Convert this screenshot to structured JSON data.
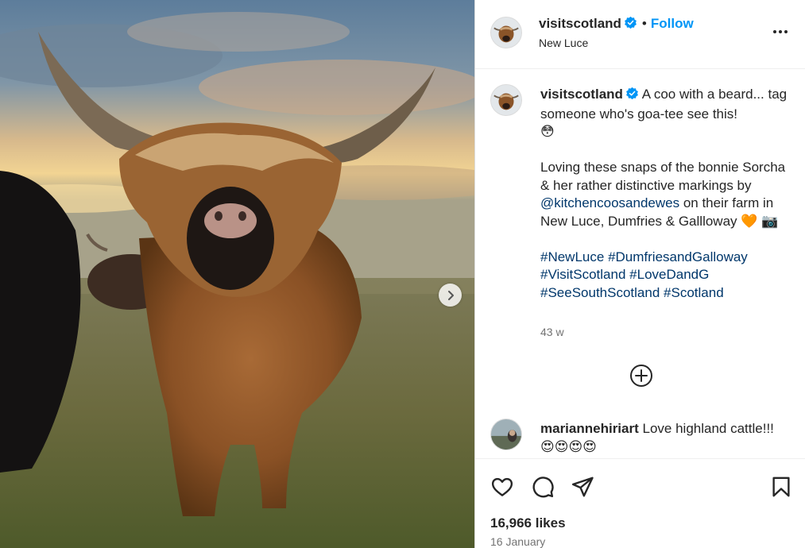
{
  "post": {
    "username": "visitscotland",
    "follow_label": "Follow",
    "separator": "•",
    "location": "New Luce",
    "more_label": "..."
  },
  "caption": {
    "username": "visitscotland",
    "line1": "A coo with a beard... tag someone who's goa-tee see this!",
    "emoji1": "😳",
    "para2_prefix": "Loving these snaps of the bonnie Sorcha & her rather distinctive markings by ",
    "mention": "@kitchencoosandewes",
    "para2_suffix": " on their farm in New Luce, Dumfries & Gallloway ",
    "emoji2": "🧡 📷",
    "hashtags": [
      "#NewLuce",
      "#DumfriesandGalloway",
      "#VisitScotland",
      "#LoveDandG",
      "#SeeSouthScotland",
      "#Scotland"
    ],
    "time_ago": "43 w"
  },
  "comment": {
    "username": "mariannehiriart",
    "text": "Love highland cattle!!!",
    "emojis": "😍😍😍😍"
  },
  "footer": {
    "likes": "16,966 likes",
    "date": "16 January"
  },
  "icons": {
    "like": "heart-icon",
    "comment": "comment-icon",
    "share": "paper-plane-icon",
    "save": "bookmark-icon",
    "more": "more-horizontal-icon",
    "next": "chevron-right-icon",
    "add_comment": "plus-circle-icon",
    "verified": "verified-badge-icon"
  },
  "colors": {
    "follow_blue": "#0095f6",
    "link_blue": "#00376b",
    "verified_blue": "#0095f6",
    "muted_text": "#737373"
  }
}
